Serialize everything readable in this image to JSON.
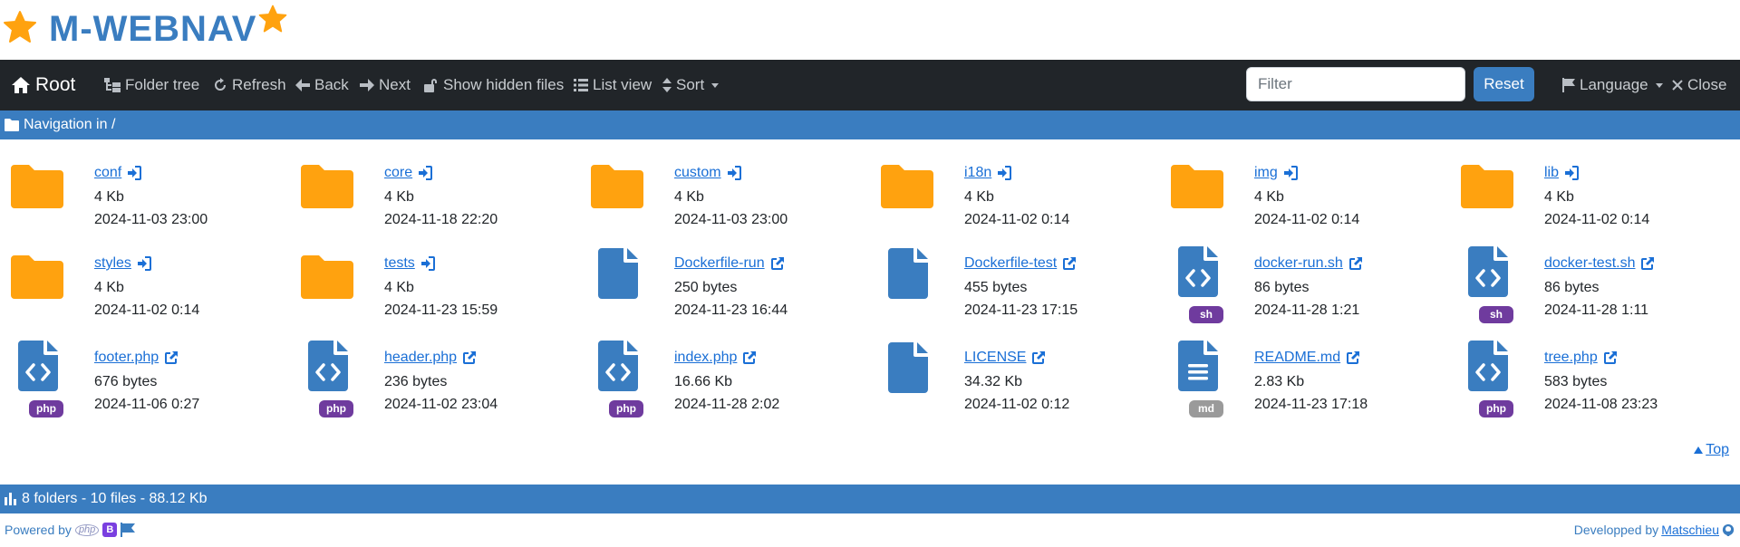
{
  "app": {
    "title": "M-WEBNAV"
  },
  "navbar": {
    "root": "Root",
    "folder_tree": "Folder tree",
    "refresh": "Refresh",
    "back": "Back",
    "next": "Next",
    "show_hidden": "Show hidden files",
    "list_view": "List view",
    "sort": "Sort",
    "filter_placeholder": "Filter",
    "reset": "Reset",
    "language": "Language",
    "close": "Close"
  },
  "breadcrumb": {
    "text": "Navigation in /"
  },
  "items": [
    {
      "name": "conf",
      "size": "4 Kb",
      "date": "2024-11-03 23:00",
      "type": "folder",
      "link": "enter"
    },
    {
      "name": "core",
      "size": "4 Kb",
      "date": "2024-11-18 22:20",
      "type": "folder",
      "link": "enter"
    },
    {
      "name": "custom",
      "size": "4 Kb",
      "date": "2024-11-03 23:00",
      "type": "folder",
      "link": "enter"
    },
    {
      "name": "i18n",
      "size": "4 Kb",
      "date": "2024-11-02 0:14",
      "type": "folder",
      "link": "enter"
    },
    {
      "name": "img",
      "size": "4 Kb",
      "date": "2024-11-02 0:14",
      "type": "folder",
      "link": "enter"
    },
    {
      "name": "lib",
      "size": "4 Kb",
      "date": "2024-11-02 0:14",
      "type": "folder",
      "link": "enter"
    },
    {
      "name": "styles",
      "size": "4 Kb",
      "date": "2024-11-02 0:14",
      "type": "folder",
      "link": "enter"
    },
    {
      "name": "tests",
      "size": "4 Kb",
      "date": "2024-11-23 15:59",
      "type": "folder",
      "link": "enter"
    },
    {
      "name": "Dockerfile-run",
      "size": "250 bytes",
      "date": "2024-11-23 16:44",
      "type": "file",
      "link": "external"
    },
    {
      "name": "Dockerfile-test",
      "size": "455 bytes",
      "date": "2024-11-23 17:15",
      "type": "file",
      "link": "external"
    },
    {
      "name": "docker-run.sh",
      "size": "86 bytes",
      "date": "2024-11-28 1:21",
      "type": "code",
      "badge": "sh",
      "link": "external"
    },
    {
      "name": "docker-test.sh",
      "size": "86 bytes",
      "date": "2024-11-28 1:11",
      "type": "code",
      "badge": "sh",
      "link": "external"
    },
    {
      "name": "footer.php",
      "size": "676 bytes",
      "date": "2024-11-06 0:27",
      "type": "code",
      "badge": "php",
      "link": "external"
    },
    {
      "name": "header.php",
      "size": "236 bytes",
      "date": "2024-11-02 23:04",
      "type": "code",
      "badge": "php",
      "link": "external"
    },
    {
      "name": "index.php",
      "size": "16.66 Kb",
      "date": "2024-11-28 2:02",
      "type": "code",
      "badge": "php",
      "link": "external"
    },
    {
      "name": "LICENSE",
      "size": "34.32 Kb",
      "date": "2024-11-02 0:12",
      "type": "file",
      "link": "external"
    },
    {
      "name": "README.md",
      "size": "2.83 Kb",
      "date": "2024-11-23 17:18",
      "type": "text",
      "badge": "md",
      "link": "external"
    },
    {
      "name": "tree.php",
      "size": "583 bytes",
      "date": "2024-11-08 23:23",
      "type": "code",
      "badge": "php",
      "link": "external"
    }
  ],
  "top_link": "Top",
  "status": {
    "text": "8 folders - 10 files - 88.12 Kb"
  },
  "footer": {
    "powered_by": "Powered by",
    "php_logo": "php",
    "bootstrap_logo": "B",
    "developed_by": "Developped by",
    "author": "Matschieu"
  },
  "colors": {
    "brand": "#3a7dc0",
    "navbar_bg": "#212529",
    "folder": "#ffa20f",
    "file": "#3a7dc0",
    "link": "#1a6fd6",
    "badge_purple": "#6f3b9e",
    "badge_gray": "#9a9a9a"
  }
}
